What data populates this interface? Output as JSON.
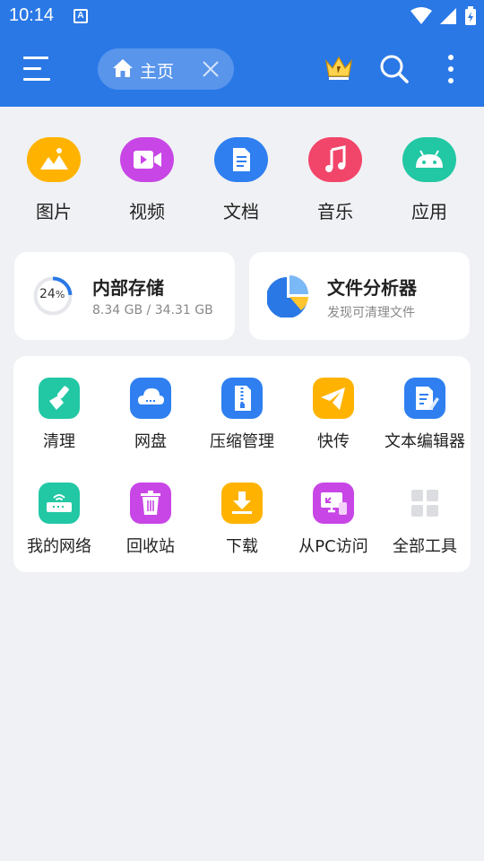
{
  "status_bar": {
    "time": "10:14",
    "notification_icon": "A"
  },
  "app_bar": {
    "tab_label": "主页"
  },
  "categories": [
    {
      "label": "图片",
      "icon": "image-icon",
      "color": "#ffb300"
    },
    {
      "label": "视频",
      "icon": "video-icon",
      "color": "#c846e6"
    },
    {
      "label": "文档",
      "icon": "document-icon",
      "color": "#2f7ff0"
    },
    {
      "label": "音乐",
      "icon": "music-icon",
      "color": "#f2456a"
    },
    {
      "label": "应用",
      "icon": "android-icon",
      "color": "#22c7a4"
    }
  ],
  "storage": {
    "title": "内部存储",
    "percent": "24",
    "percent_sign": "%",
    "usage": "8.34 GB / 34.31 GB"
  },
  "analyzer": {
    "title": "文件分析器",
    "subtitle": "发现可清理文件"
  },
  "tools": [
    {
      "label": "清理",
      "icon": "broom-icon",
      "color": "#22c7a4"
    },
    {
      "label": "网盘",
      "icon": "cloud-icon",
      "color": "#2f7ff0"
    },
    {
      "label": "压缩管理",
      "icon": "zip-icon",
      "color": "#2f7ff0"
    },
    {
      "label": "快传",
      "icon": "send-icon",
      "color": "#ffb300"
    },
    {
      "label": "文本编辑器",
      "icon": "text-edit-icon",
      "color": "#2f7ff0"
    },
    {
      "label": "我的网络",
      "icon": "router-icon",
      "color": "#22c7a4"
    },
    {
      "label": "回收站",
      "icon": "trash-icon",
      "color": "#c846e6"
    },
    {
      "label": "下载",
      "icon": "download-icon",
      "color": "#ffb300"
    },
    {
      "label": "从PC访问",
      "icon": "pc-access-icon",
      "color": "#c846e6"
    },
    {
      "label": "全部工具",
      "icon": "grid-icon",
      "color": "#dcdde0"
    }
  ]
}
